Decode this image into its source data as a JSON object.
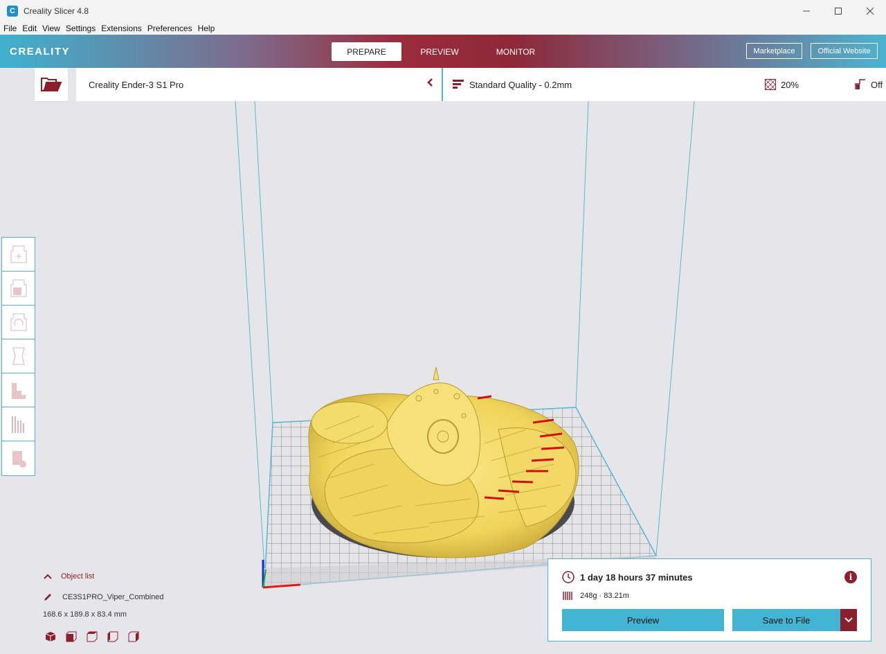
{
  "window": {
    "title": "Creality Slicer 4.8",
    "app_icon_glyph": "C",
    "controls": [
      "minimize-icon",
      "maximize-icon",
      "close-icon"
    ]
  },
  "menu": [
    "File",
    "Edit",
    "View",
    "Settings",
    "Extensions",
    "Preferences",
    "Help"
  ],
  "header": {
    "logo": "CREALITY",
    "tabs": [
      {
        "label": "PREPARE",
        "active": true
      },
      {
        "label": "PREVIEW",
        "active": false
      },
      {
        "label": "MONITOR",
        "active": false
      }
    ],
    "marketplace_label": "Marketplace",
    "website_label": "Official Website"
  },
  "toolbar": {
    "open_icon": "folder-open-icon",
    "printer": "Creality Ender-3 S1 Pro",
    "quality": "Standard Quality - 0.2mm",
    "infill": "20%",
    "support": "Off"
  },
  "left_tools": [
    "move-tool-icon",
    "scale-tool-icon",
    "rotate-tool-icon",
    "mirror-tool-icon",
    "per-model-settings-icon",
    "support-blocker-icon",
    "custom-support-icon"
  ],
  "object_list": {
    "toggle_label": "Object list",
    "object_name": "CE3S1PRO_Viper_Combined",
    "dimensions": "168.6 x 189.8 x 83.4 mm",
    "view_buttons": [
      "3d-view-icon",
      "front-view-icon",
      "top-view-icon",
      "left-view-icon",
      "right-view-icon"
    ]
  },
  "print": {
    "time": "1 day 18 hours 37 minutes",
    "material": "248g · 83.21m",
    "preview_label": "Preview",
    "save_label": "Save to File"
  },
  "colors": {
    "accent_blue": "#4fb4d4",
    "accent_red": "#8a1f2e",
    "model_yellow": "#f2dc6a",
    "overhang_red": "#d01010"
  }
}
